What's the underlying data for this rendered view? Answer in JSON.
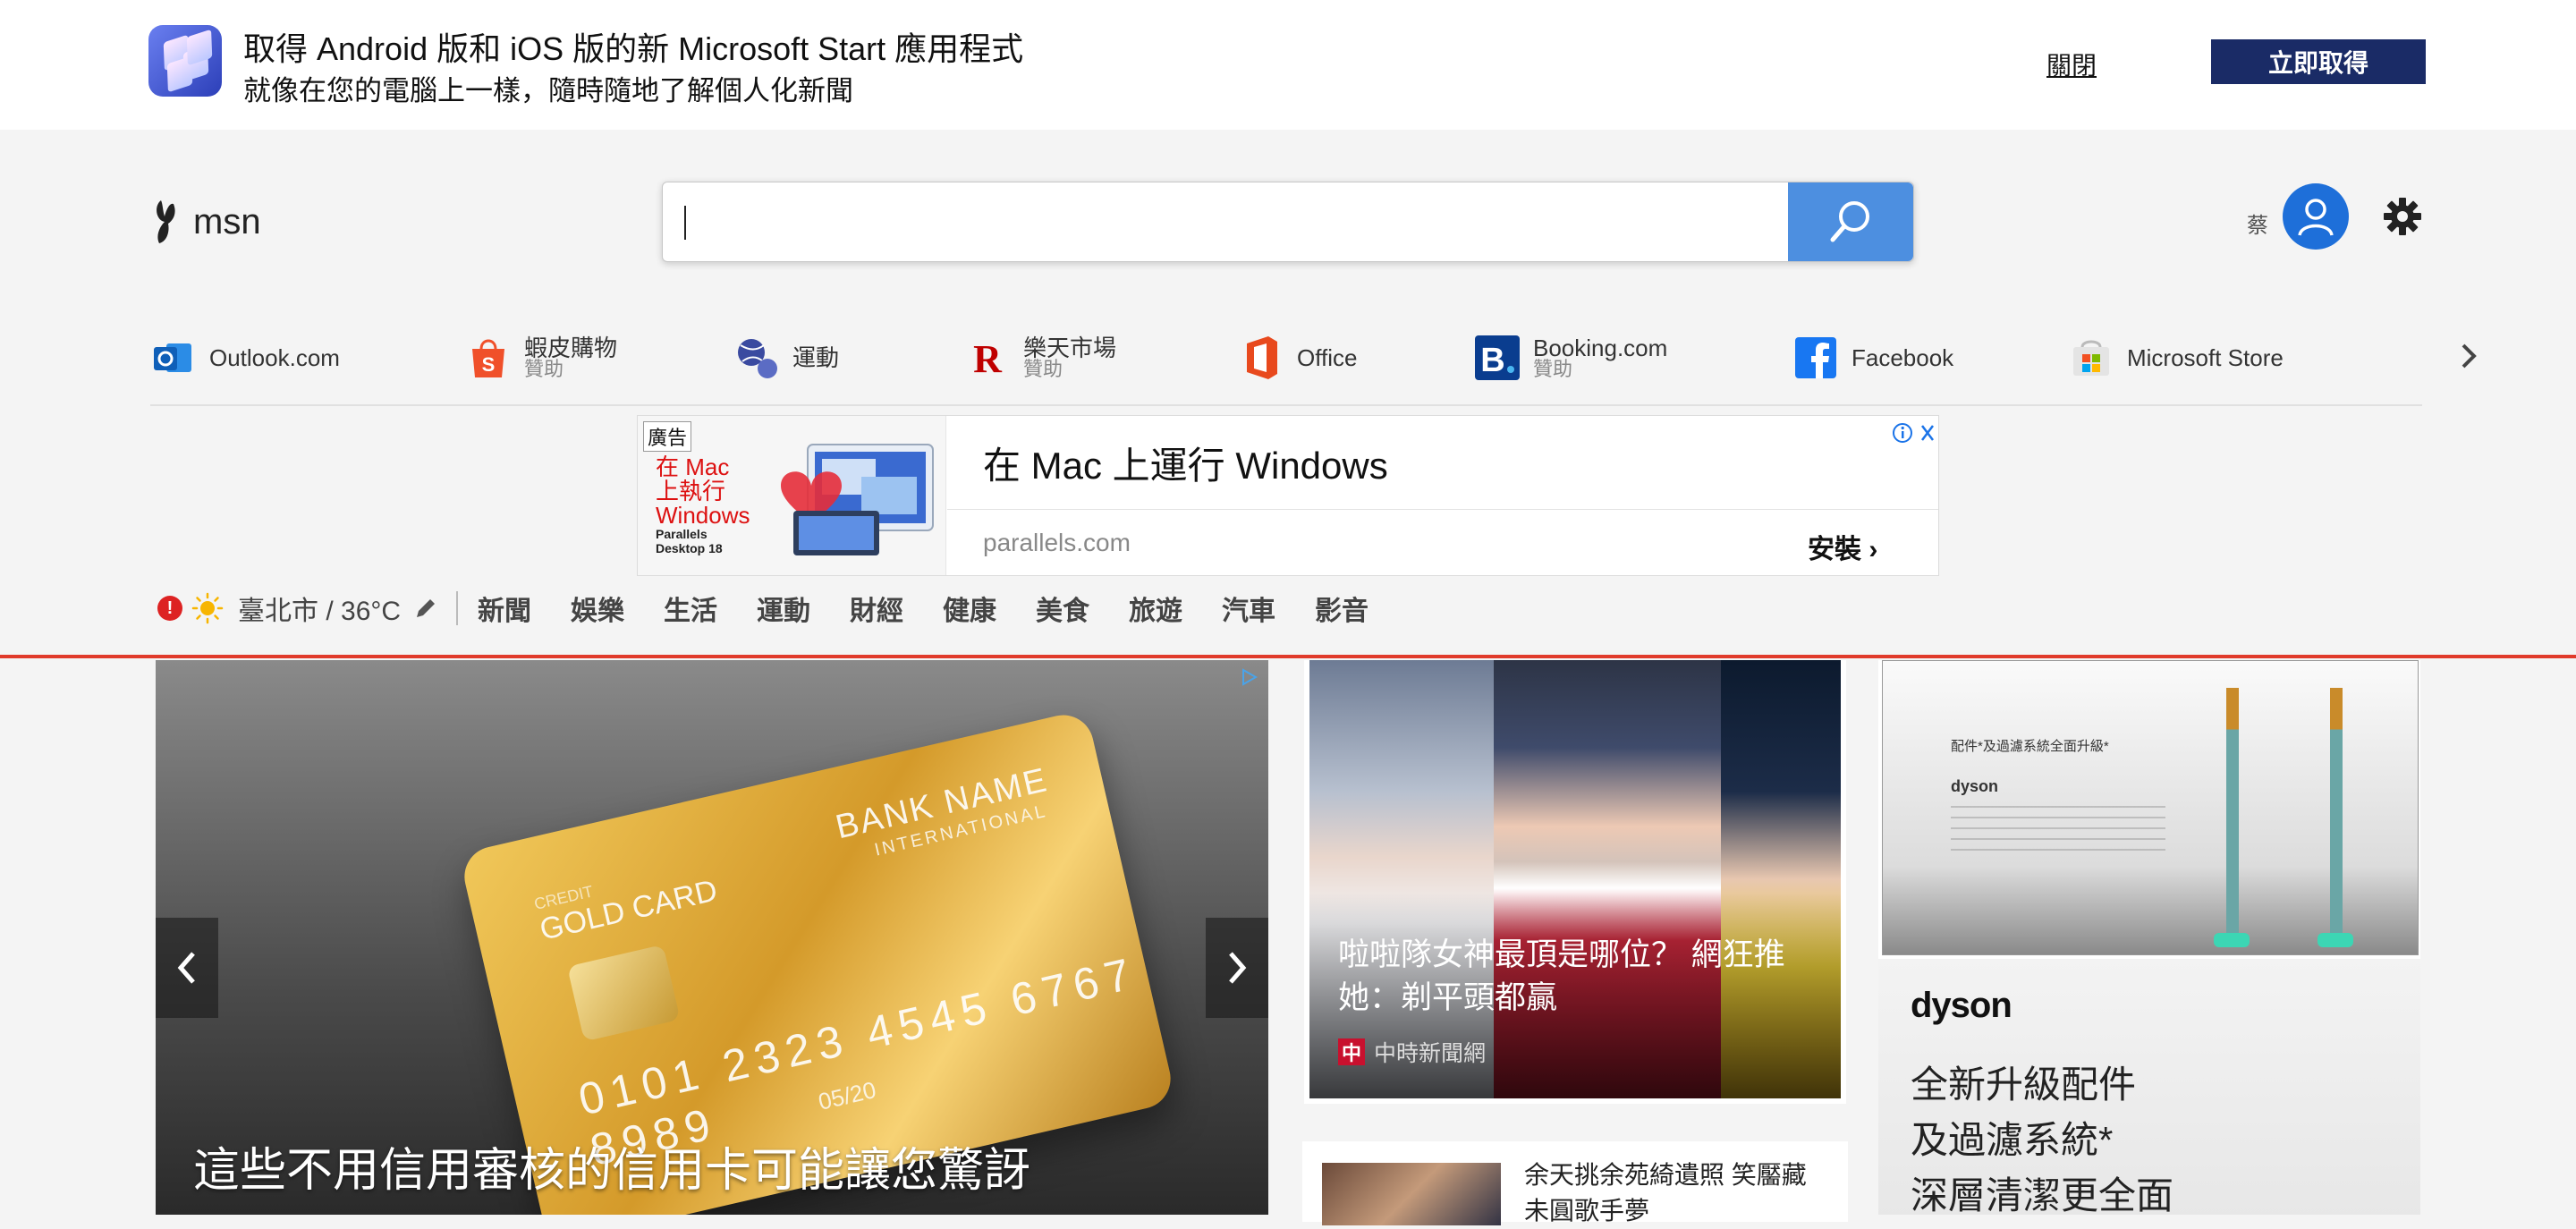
{
  "promo": {
    "title": "取得 Android 版和 iOS 版的新 Microsoft Start 應用程式",
    "subtitle": "就像在您的電腦上一樣，隨時隨地了解個人化新聞",
    "close_label": "關閉",
    "get_label": "立即取得"
  },
  "header": {
    "logo_text": "msn",
    "search_value": "",
    "user_initial": "蔡"
  },
  "quick_links": [
    {
      "label": "Outlook.com",
      "sponsored": "",
      "icon": "outlook-icon"
    },
    {
      "label": "蝦皮購物",
      "sponsored": "贊助",
      "icon": "shopee-icon"
    },
    {
      "label": "運動",
      "sponsored": "",
      "icon": "sports-icon"
    },
    {
      "label": "樂天市場",
      "sponsored": "贊助",
      "icon": "rakuten-icon"
    },
    {
      "label": "Office",
      "sponsored": "",
      "icon": "office-icon"
    },
    {
      "label": "Booking.com",
      "sponsored": "贊助",
      "icon": "booking-icon"
    },
    {
      "label": "Facebook",
      "sponsored": "",
      "icon": "facebook-icon"
    },
    {
      "label": "Microsoft Store",
      "sponsored": "",
      "icon": "store-icon"
    }
  ],
  "ad": {
    "tag": "廣告",
    "image_text": "在 Mac\n上執行\nWindows",
    "brand_text": "Parallels\nDesktop 18",
    "headline": "在 Mac 上運行 Windows",
    "domain": "parallels.com",
    "install_label": "安裝"
  },
  "nav": {
    "weather": "臺北市 / 36°C",
    "alert_symbol": "!",
    "items": [
      "新聞",
      "娛樂",
      "生活",
      "運動",
      "財經",
      "健康",
      "美食",
      "旅遊",
      "汽車",
      "影音"
    ]
  },
  "hero": {
    "title": "這些不用信用審核的信用卡可能讓您驚訝",
    "card_bank": "BANK NAME",
    "card_intl": "INTERNATIONAL",
    "card_type": "GOLD CARD",
    "card_credit": "CREDIT",
    "card_number": "0101 2323 4545 6767 8989",
    "card_expiry": "05/20"
  },
  "mid": {
    "title": "啦啦隊女神最頂是哪位？ 網狂推她：剃平頭都贏",
    "source": "中時新聞網",
    "source_logo": "中"
  },
  "mini": {
    "title": "余天挑余苑綺遺照 笑靨藏未圓歌手夢"
  },
  "right_ad": {
    "caption": "配件*及過濾系統全面升級*",
    "small_logo": "dyson",
    "logo": "dyson",
    "copy": "全新升級配件\n及過濾系統*\n深層清潔更全面"
  },
  "colors": {
    "accent_red": "#e03a2a",
    "search_button": "#4d8fe0",
    "get_button": "#1a2b66",
    "avatar": "#1e6fd9"
  }
}
